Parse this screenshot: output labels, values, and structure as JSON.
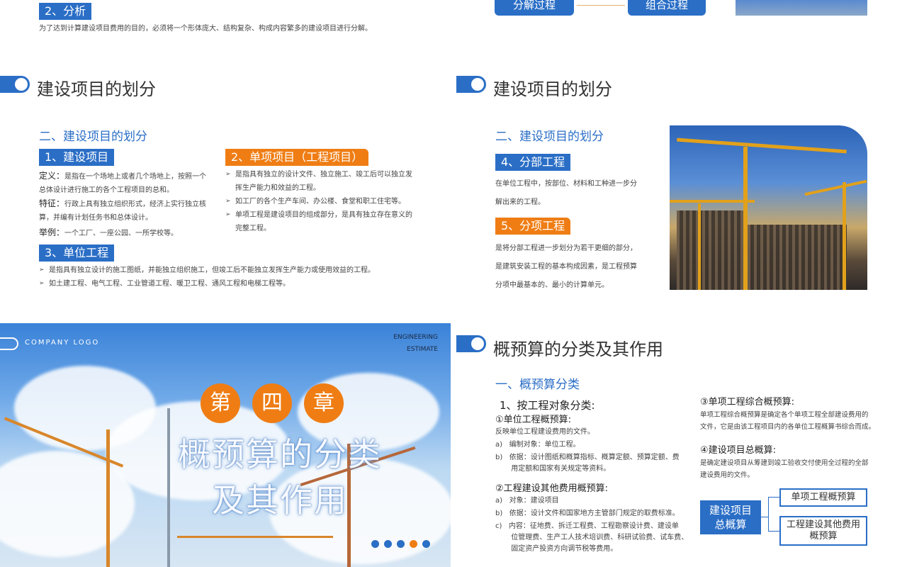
{
  "top_left": {
    "tag": "2、分析",
    "text": "为了达到计算建设项目费用的目的，必须将一个形体庞大、结构复杂、构成内容繁多的建设项目进行分解。"
  },
  "top_right": {
    "box1": "分解过程",
    "box2": "组合过程"
  },
  "slide1": {
    "title": "建设项目的划分",
    "subtitle": "二、建设项目的划分",
    "tag1": "1、建设项目",
    "def_label": "定义：",
    "def_text_1": "是指在一个场地上或者几个场地上，按照一个",
    "def_text_2": "总体设计进行施工的各个工程项目的总和。",
    "feat_label": "特征：",
    "feat_text_1": "行政上具有独立组织形式，经济上实行独立核",
    "feat_text_2": "算，并编有计划任务书和总体设计。",
    "ex_label": "举例：",
    "ex_text": "一个工厂、一座公园、一所学校等。",
    "tag2": "2、单项项目（工程项目）",
    "b2": [
      "是指具有独立的设计文件、独立施工、竣工后可以独立发挥生产能力和效益的工程。",
      "如工厂的各个生产车间、办公楼、食堂和职工住宅等。",
      "单项工程是建设项目的组成部分，是具有独立存在意义的完整工程。"
    ],
    "tag3": "3、单位工程",
    "b3": [
      "是指具有独立设计的施工图纸，并能独立组织施工，但竣工后不能独立发挥生产能力或使用效益的工程。",
      "如土建工程、电气工程、工业管道工程、暖卫工程、通风工程和电梯工程等。"
    ]
  },
  "slide2": {
    "title": "建设项目的划分",
    "subtitle": "二、建设项目的划分",
    "tag4": "4、分部工程",
    "text4_1": "在单位工程中，按部位、材料和工种进一步分",
    "text4_2": "解出来的工程。",
    "tag5": "5、分项工程",
    "text5_1": "是将分部工程进一步划分为若干更细的部分，",
    "text5_2": "是建筑安装工程的基本构成因素，是工程预算",
    "text5_3": "分项中最基本的、最小的计算单元。"
  },
  "slide3": {
    "logo": "COMPANY LOGO",
    "brand_1": "ENGINEERING",
    "brand_2": "ESTIMATE",
    "chapter_chars": [
      "第",
      "四",
      "章"
    ],
    "title_line1": "概预算的分类",
    "title_line2": "及其作用",
    "dots_colors": [
      "#2a6ec6",
      "#2a6ec6",
      "#2a6ec6",
      "#ef7d14",
      "#2a6ec6"
    ]
  },
  "slide4": {
    "title": "概预算的分类及其作用",
    "subtitle": "一、概预算分类",
    "h1": "1、按工程对象分类:",
    "s1_title": "①单位工程概预算:",
    "s1_desc": "反映单位工程建设费用的文件。",
    "s1_a": "a)   编制对象：单位工程。",
    "s1_b1": "b)   依据：设计图纸和概算指标、概算定额、预算定额、费",
    "s1_b2": "       用定额和国家有关规定等资料。",
    "s2_title": "②工程建设其他费用概预算:",
    "s2_a": "a)   对象：建设项目",
    "s2_b": "b)   依据：设计文件和国家地方主管部门规定的取费标准。",
    "s2_c1": "c)   内容：征地费、拆迁工程费、工程勘察设计费、建设单",
    "s2_c2": "       位管理费、生产工人技术培训费、科研试验费、试车费、",
    "s2_c3": "       固定资产投资方向调节税等费用。",
    "s3_title": "③单项工程综合概预算:",
    "s3_1": "单项工程综合概预算是确定各个单项工程全部建设费用的",
    "s3_2": "文件，它是由该工程项目内的各单位工程概算书综合而成。",
    "s4_title": "④建设项目总概算:",
    "s4_1": "是确定建设项目从筹建到竣工验收交付使用全过程的全部",
    "s4_2": "建设费用的文件。",
    "box_main_1": "建设项目",
    "box_main_2": "总概算",
    "box_a": "单项工程概预算",
    "box_b_1": "工程建设其他费用",
    "box_b_2": "概预算"
  }
}
